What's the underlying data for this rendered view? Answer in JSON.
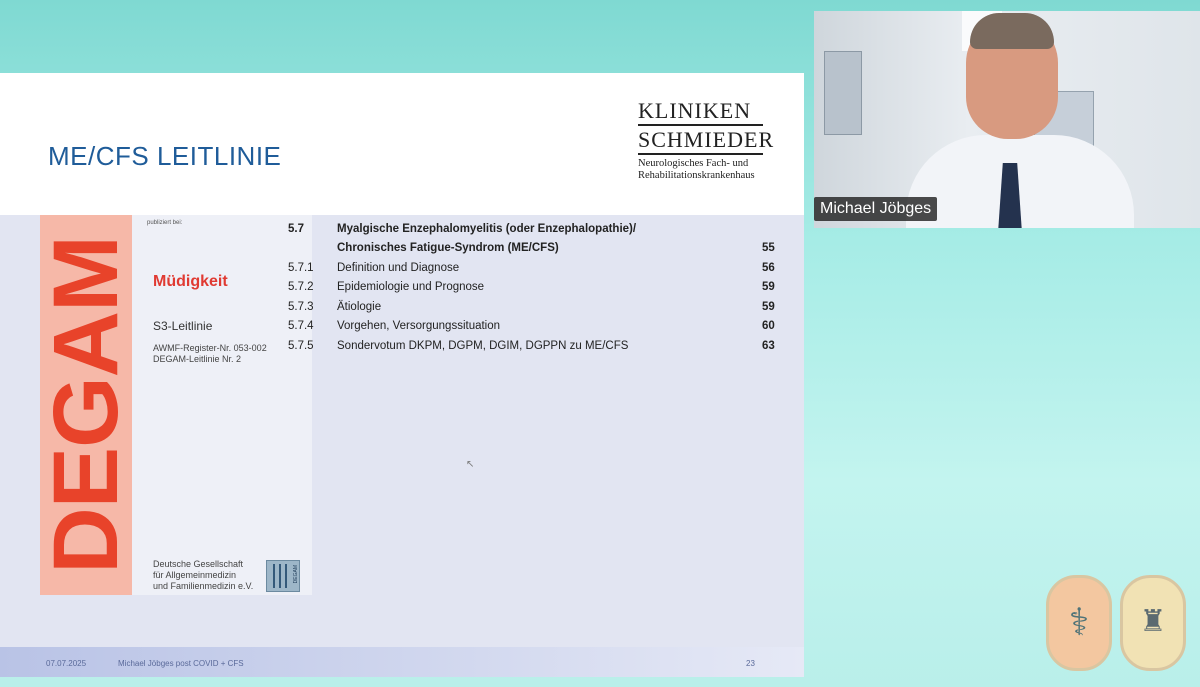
{
  "slide": {
    "title": "ME/CFS LEITLINIE",
    "logo": {
      "line1": "KLINIKEN",
      "line2": "SCHMIEDER",
      "line3": "Neurologisches Fach- und",
      "line4": "Rehabilitationskrankenhaus"
    },
    "cover": {
      "band_text": "DEGAM",
      "publisher": "publiziert bei:",
      "title": "Müdigkeit",
      "subtitle": "S3-Leitlinie",
      "register_line1": "AWMF-Register-Nr. 053-002",
      "register_line2": "DEGAM-Leitlinie Nr. 2",
      "org_line1": "Deutsche Gesellschaft",
      "org_line2": "für Allgemeinmedizin",
      "org_line3": "und Familienmedizin e.V.",
      "logo_text": "DEGAM"
    },
    "toc": [
      {
        "num": "5.7",
        "text": "Myalgische Enzephalomyelitis (oder Enzephalopathie)/",
        "page": "",
        "bold": true
      },
      {
        "num": "",
        "text": "Chronisches Fatigue-Syndrom (ME/CFS)",
        "page": "55",
        "bold": true
      },
      {
        "num": "5.7.1",
        "text": "Definition und Diagnose",
        "page": "56",
        "bold": false
      },
      {
        "num": "5.7.2",
        "text": "Epidemiologie und Prognose",
        "page": "59",
        "bold": false
      },
      {
        "num": "5.7.3",
        "text": "Ätiologie",
        "page": "59",
        "bold": false
      },
      {
        "num": "5.7.4",
        "text": "Vorgehen, Versorgungssituation",
        "page": "60",
        "bold": false
      },
      {
        "num": "5.7.5",
        "text": "Sondervotum DKPM, DGPM, DGIM, DGPPN zu ME/CFS",
        "page": "63",
        "bold": false
      }
    ],
    "footer": {
      "date": "07.07.2025",
      "presenter": "Michael Jöbges post COVID + CFS",
      "page": "23"
    }
  },
  "video": {
    "participant_name": "Michael Jöbges"
  },
  "colors": {
    "title_blue": "#1f5c99",
    "degam_red": "#e8432a",
    "degam_band": "#f6b8a8",
    "background_teal": "#a6ece6"
  },
  "icons": {
    "cursor": "cursor-icon",
    "crest_left": "caduceus-crest-icon",
    "crest_right": "lions-crest-icon"
  }
}
